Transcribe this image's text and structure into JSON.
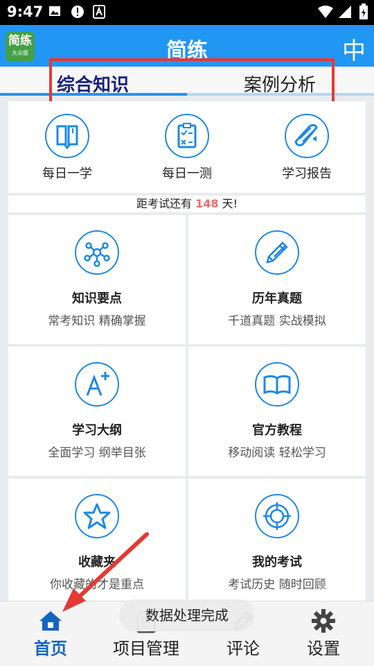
{
  "status_bar": {
    "time": "9:47",
    "icons": [
      "image-icon",
      "alert-icon",
      "a-notification-icon",
      "wifi-icon",
      "signal-icon",
      "battery-icon"
    ]
  },
  "header": {
    "logo_main": "简练",
    "logo_sub": "大众版",
    "title": "简练",
    "lang_label": "中"
  },
  "tabs": [
    {
      "label": "综合知识",
      "active": true
    },
    {
      "label": "案例分析",
      "active": false
    }
  ],
  "quick_actions": [
    {
      "label": "每日一学",
      "icon": "book-icon"
    },
    {
      "label": "每日一测",
      "icon": "clipboard-check-icon"
    },
    {
      "label": "学习报告",
      "icon": "scroll-report-icon"
    }
  ],
  "countdown": {
    "prefix": "距考试还有",
    "days": "148",
    "suffix": "天!"
  },
  "features": [
    {
      "title": "知识要点",
      "subtitle": "常考知识 精确掌握",
      "icon": "network-icon"
    },
    {
      "title": "历年真题",
      "subtitle": "千道真题 实战模拟",
      "icon": "pencil-icon"
    },
    {
      "title": "学习大纲",
      "subtitle": "全面学习 纲举目张",
      "icon": "a-plus-icon"
    },
    {
      "title": "官方教程",
      "subtitle": "移动阅读 轻松学习",
      "icon": "open-book-icon"
    },
    {
      "title": "收藏夹",
      "subtitle": "你收藏的才是重点",
      "icon": "star-icon"
    },
    {
      "title": "我的考试",
      "subtitle": "考试历史 随时回顾",
      "icon": "target-icon"
    }
  ],
  "bottom_nav": [
    {
      "label": "首页",
      "icon": "home-icon",
      "active": true
    },
    {
      "label": "项目管理",
      "icon": "project-icon",
      "active": false
    },
    {
      "label": "评论",
      "icon": "comment-icon",
      "active": false
    },
    {
      "label": "设置",
      "icon": "gear-icon",
      "active": false
    }
  ],
  "toast": "数据处理完成",
  "colors": {
    "primary": "#2196f3",
    "tab_active_text": "#1a237e",
    "icon_blue": "#1e88e5",
    "countdown_number": "#ef6c6c",
    "annotation_red": "#e53935",
    "logo_green": "#43a047"
  }
}
